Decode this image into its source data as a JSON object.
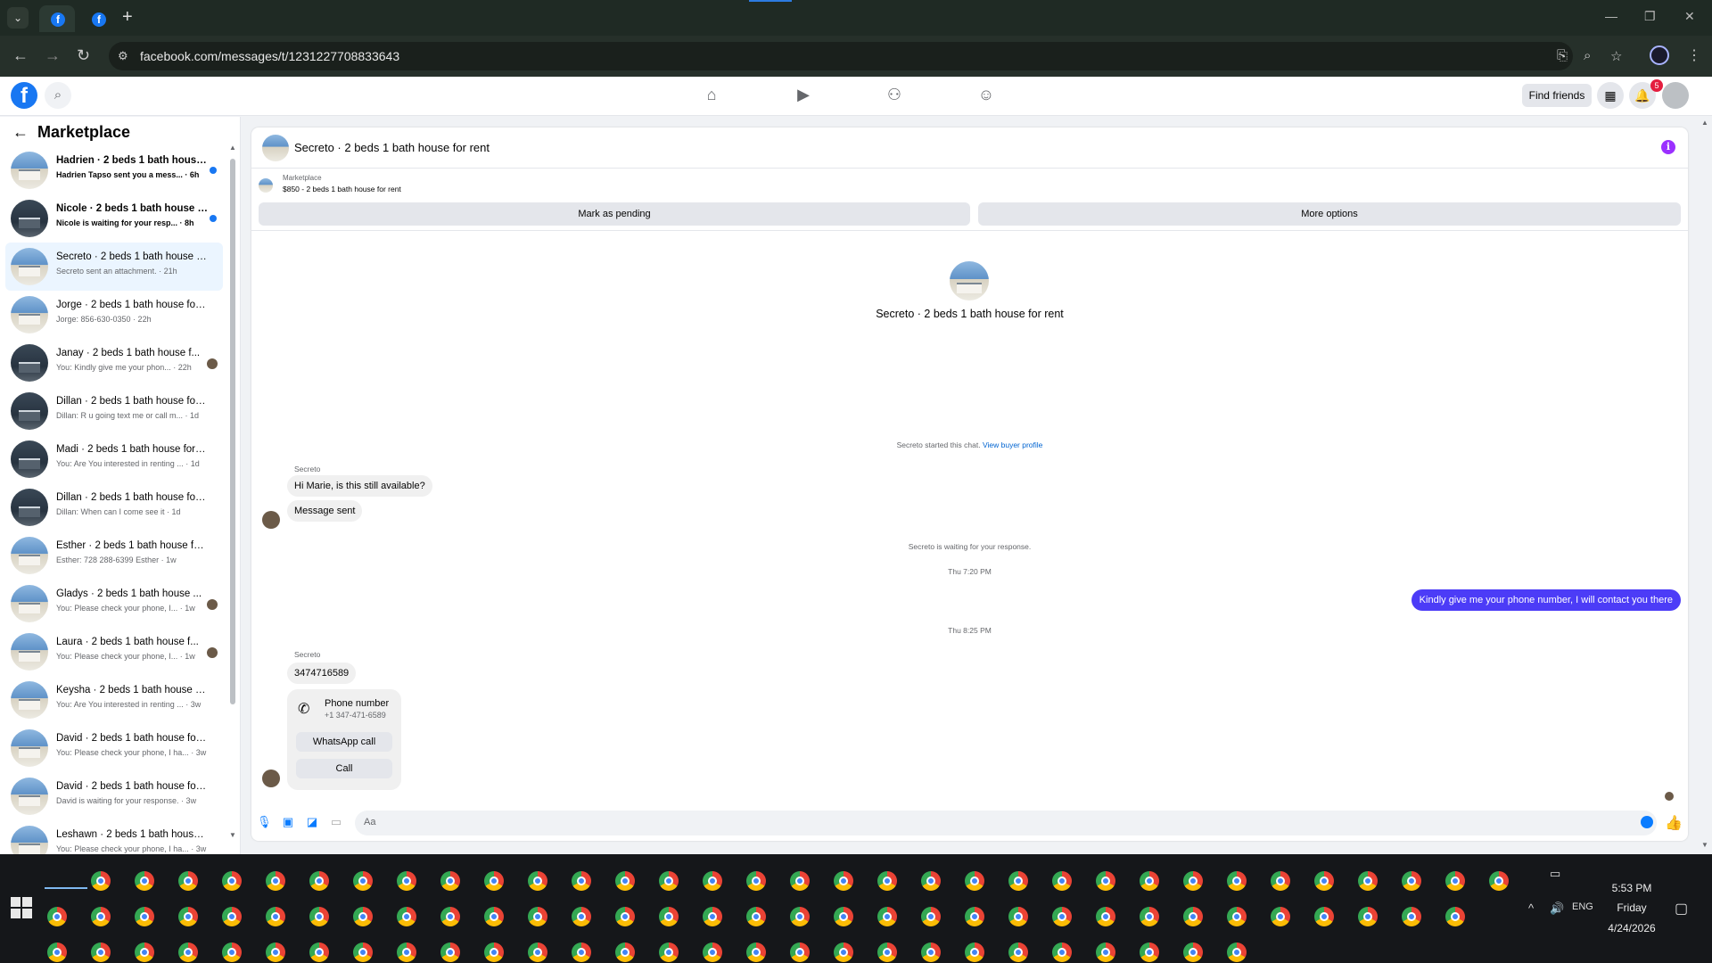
{
  "browser": {
    "url": "facebook.com/messages/t/1231227708833643",
    "tabs": [
      "Facebook",
      "Facebook"
    ]
  },
  "header": {
    "find_friends": "Find friends",
    "notification_count": "5"
  },
  "sidebar": {
    "title": "Marketplace",
    "conversations": [
      {
        "title": "Hadrien · 2 beds 1 bath house...",
        "sub": "Hadrien Tapso sent you a mess... · 6h",
        "unread": true,
        "dark": false
      },
      {
        "title": "Nicole · 2 beds 1 bath house f...",
        "sub": "Nicole is waiting for your resp... · 8h",
        "unread": true,
        "dark": true
      },
      {
        "title": "Secreto · 2 beds 1 bath house f...",
        "sub": "Secreto sent an attachment. · 21h",
        "unread": false,
        "dark": false,
        "selected": true
      },
      {
        "title": "Jorge · 2 beds 1 bath house for ...",
        "sub": "Jorge: 856-630-0350 · 22h",
        "unread": false,
        "dark": false
      },
      {
        "title": "Janay · 2 beds 1 bath house f...",
        "sub": "You: Kindly give me your phon... · 22h",
        "unread": false,
        "dark": true,
        "seen": true
      },
      {
        "title": "Dillan · 2 beds 1 bath house for ...",
        "sub": "Dillan: R u going text me or call m... · 1d",
        "unread": false,
        "dark": true
      },
      {
        "title": "Madi · 2 beds 1 bath house for r...",
        "sub": "You: Are You interested in renting ... · 1d",
        "unread": false,
        "dark": true
      },
      {
        "title": "Dillan · 2 beds 1 bath house for ...",
        "sub": "Dillan: When can I come see it · 1d",
        "unread": false,
        "dark": true
      },
      {
        "title": "Esther · 2 beds 1 bath house for...",
        "sub": "Esther: 728 288-6399 Esther · 1w",
        "unread": false,
        "dark": false
      },
      {
        "title": "Gladys · 2 beds 1 bath house ...",
        "sub": "You: Please check your phone, I... · 1w",
        "unread": false,
        "dark": false,
        "seen": true
      },
      {
        "title": "Laura · 2 beds 1 bath house f...",
        "sub": "You: Please check your phone, I... · 1w",
        "unread": false,
        "dark": false,
        "seen": true
      },
      {
        "title": "Keysha · 2 beds 1 bath house fo...",
        "sub": "You: Are You interested in renting ... · 3w",
        "unread": false,
        "dark": false
      },
      {
        "title": "David · 2 beds 1 bath house for ...",
        "sub": "You: Please check your phone, I ha... · 3w",
        "unread": false,
        "dark": false
      },
      {
        "title": "David · 2 beds 1 bath house for ...",
        "sub": "David is waiting for your response. · 3w",
        "unread": false,
        "dark": false
      },
      {
        "title": "Leshawn · 2 beds 1 bath house f...",
        "sub": "You: Please check your phone, I ha... · 3w",
        "unread": false,
        "dark": false
      }
    ]
  },
  "chat": {
    "title": "Secreto · 2 beds 1 bath house for rent",
    "marketplace_label": "Marketplace",
    "listing": "$850 - 2 beds 1 bath house for rent",
    "mark_pending": "Mark as pending",
    "more_options": "More options",
    "profile_name": "Secreto · 2 beds 1 bath house for rent",
    "started_text": "Secreto started this chat.",
    "view_buyer_profile": "View buyer profile",
    "sender_name": "Secreto",
    "msg1": "Hi Marie, is this still available?",
    "msg2": "Message sent",
    "waiting_text": "Secreto is waiting for your response.",
    "time1": "Thu 7:20 PM",
    "out_msg": "Kindly give me your phone number, I will contact you there",
    "time2": "Thu 8:25 PM",
    "msg3": "3474716589",
    "phone_card": {
      "label": "Phone number",
      "number": "+1 347-471-6589",
      "whatsapp": "WhatsApp call",
      "call": "Call"
    },
    "composer_placeholder": "Aa"
  },
  "taskbar": {
    "time": "5:53 PM",
    "day": "Friday",
    "date": "4/24/2026",
    "lang": "ENG"
  }
}
